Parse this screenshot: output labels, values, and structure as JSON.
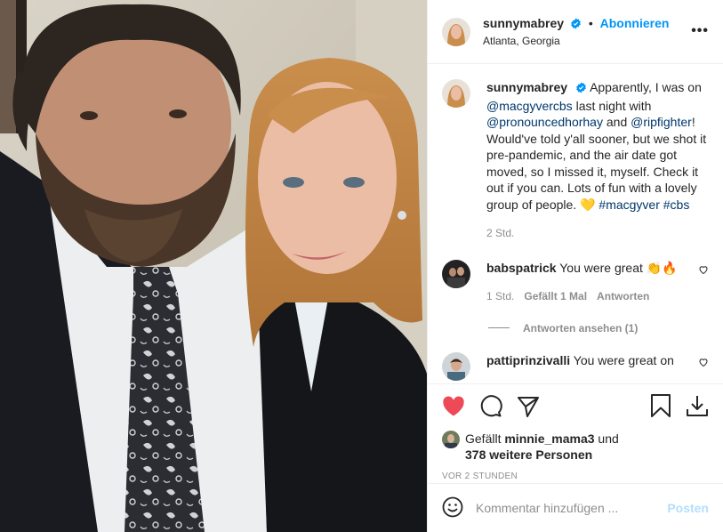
{
  "header": {
    "username": "sunnymabrey",
    "dot": "•",
    "follow_label": "Abonnieren",
    "location": "Atlanta, Georgia",
    "more_label": "•••"
  },
  "caption": {
    "username": "sunnymabrey",
    "text_1": "Apparently, I was on ",
    "mention_1": "@macgyvercbs",
    "text_2": " last night with ",
    "mention_2": "@pronouncedhorhay",
    "text_3": " and ",
    "mention_3": "@ripfighter",
    "text_4": "! Would've told y'all sooner, but we shot it pre-pandemic, and the air date got moved, so I missed it, myself. Check it out if you can. Lots of fun with a lovely group of people. 💛 ",
    "tag_1": "#macgyver",
    "tag_2": "#cbs",
    "time": "2 Std."
  },
  "comments": [
    {
      "username": "babspatrick",
      "text": "You were great 👏🔥",
      "time": "1 Std.",
      "likes": "Gefällt 1 Mal",
      "reply": "Antworten",
      "view_replies": "Antworten ansehen (1)"
    },
    {
      "username": "pattiprinzivalli",
      "text": "You were great on"
    }
  ],
  "likes": {
    "prefix": "Gefällt ",
    "user": "minnie_mama3",
    "middle": " und",
    "others": "378 weitere Personen"
  },
  "timestamp": "VOR 2 STUNDEN",
  "add_comment": {
    "placeholder": "Kommentar hinzufügen ...",
    "post_label": "Posten"
  },
  "colors": {
    "accent": "#0095f6",
    "like_red": "#ed4956",
    "muted": "#8e8e8e"
  }
}
